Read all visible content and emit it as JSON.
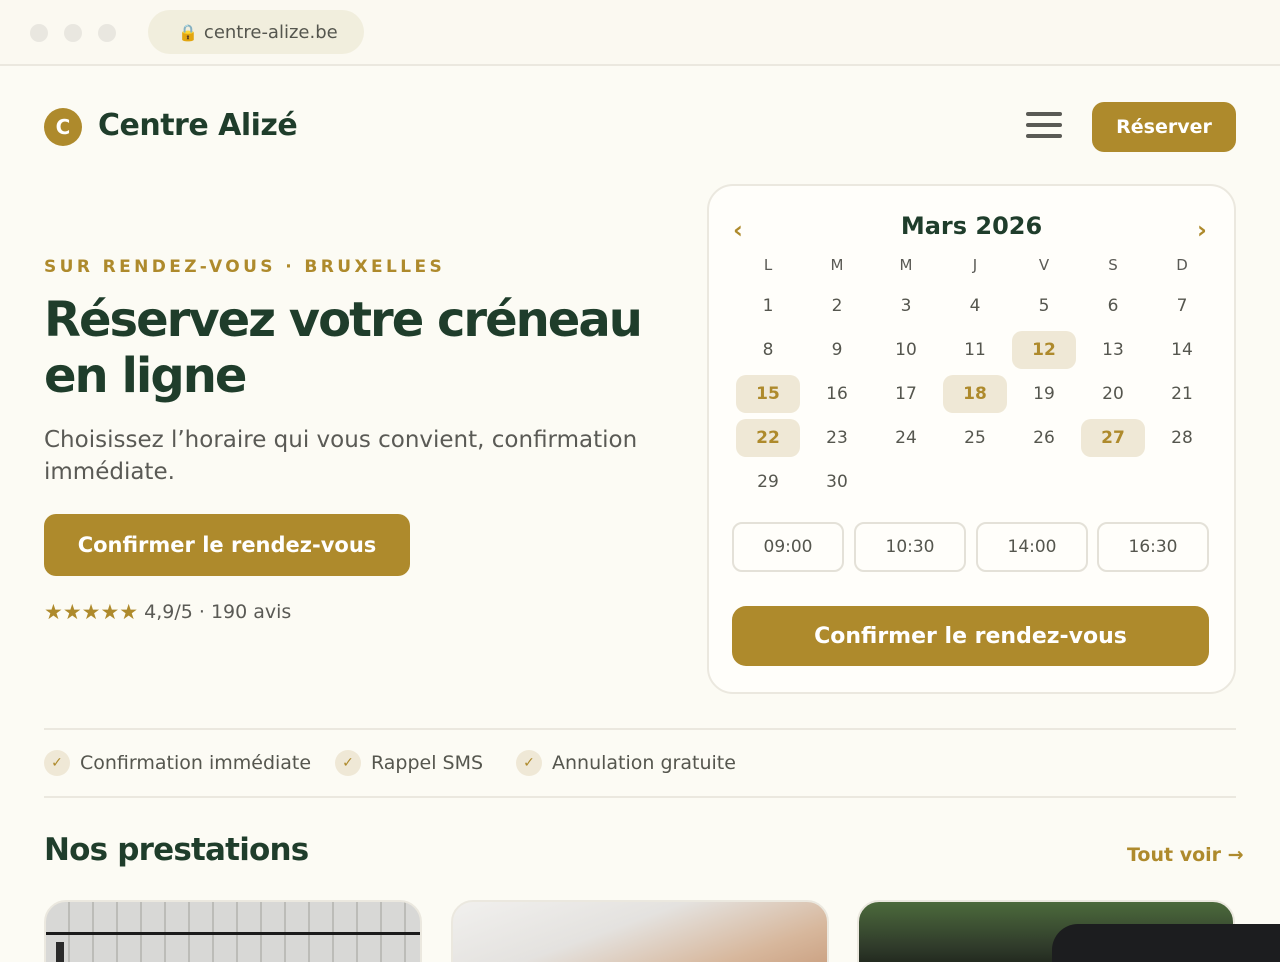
{
  "browser": {
    "url": "centre-alize.be"
  },
  "header": {
    "logo_letter": "C",
    "brand": "Centre Alizé",
    "reserve_label": "Réserver"
  },
  "hero": {
    "eyebrow": "SUR RENDEZ-VOUS · BRUXELLES",
    "title": "Réservez votre créneau en ligne",
    "subtitle": "Choisissez l’horaire qui vous convient, confirmation immédiate.",
    "cta": "Confirmer le rendez-vous",
    "stars": "★★★★★",
    "rating": "4,9/5 · 190 avis"
  },
  "calendar": {
    "month": "Mars 2026",
    "prev_icon": "‹",
    "next_icon": "›",
    "weekdays": [
      "L",
      "M",
      "M",
      "J",
      "V",
      "S",
      "D"
    ],
    "days": [
      "1",
      "2",
      "3",
      "4",
      "5",
      "6",
      "7",
      "8",
      "9",
      "10",
      "11",
      "12",
      "13",
      "14",
      "15",
      "16",
      "17",
      "18",
      "19",
      "20",
      "21",
      "22",
      "23",
      "24",
      "25",
      "26",
      "27",
      "28",
      "29",
      "30"
    ],
    "available_days": [
      "12",
      "15",
      "18",
      "22",
      "27"
    ],
    "slots": [
      "09:00",
      "10:30",
      "14:00",
      "16:30"
    ],
    "cta": "Confirmer le rendez-vous"
  },
  "features": [
    {
      "label": "Confirmation immédiate"
    },
    {
      "label": "Rappel SMS"
    },
    {
      "label": "Annulation gratuite"
    }
  ],
  "check_icon": "✓",
  "services": {
    "title": "Nos prestations",
    "see_all": "Tout voir →"
  },
  "colors": {
    "accent": "#ae8a2c",
    "heading": "#1f3d2b",
    "background": "#fcfbf4",
    "available_bg": "#efe8d6"
  }
}
